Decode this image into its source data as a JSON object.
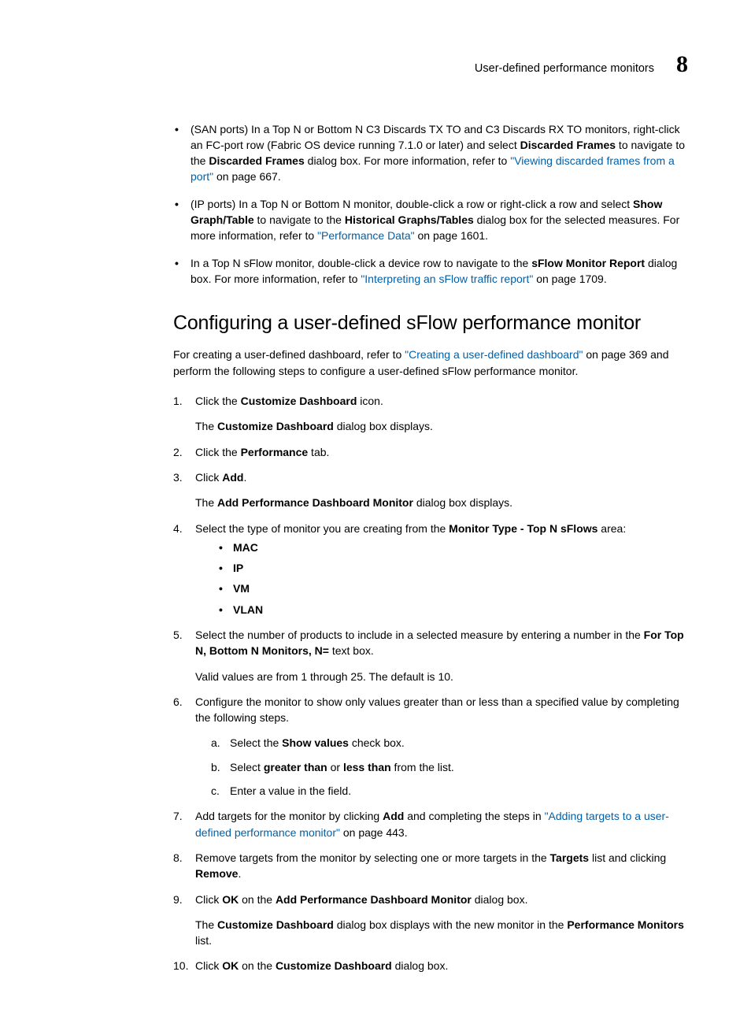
{
  "runningHead": {
    "title": "User-defined performance monitors",
    "chapter": "8"
  },
  "topBullets": [
    {
      "pre": "(SAN ports) In a Top N or Bottom N C3 Discards TX TO and C3 Discards RX TO monitors, right-click an FC-port row (Fabric OS device running 7.1.0 or later) and select ",
      "bold1": "Discarded Frames",
      "mid1": " to navigate to the ",
      "bold2": "Discarded Frames",
      "mid2": " dialog box. For more information, refer to ",
      "link": "\"Viewing discarded frames from a port\"",
      "post": " on page 667."
    },
    {
      "pre": "(IP ports) In a Top N or Bottom N monitor, double-click a row or right-click a row and select ",
      "bold1": "Show Graph/Table",
      "mid1": " to navigate to the ",
      "bold2": "Historical Graphs/Tables",
      "mid2": " dialog box for the selected measures. For more information, refer to ",
      "link": "\"Performance Data\"",
      "post": " on page 1601."
    },
    {
      "pre": "In a Top N sFlow monitor, double-click a device row to navigate to the ",
      "bold1": "sFlow Monitor Report",
      "mid1": " dialog box. For more information, refer to ",
      "bold2": "",
      "mid2": "",
      "link": "\"Interpreting an sFlow traffic report\"",
      "post": " on page 1709."
    }
  ],
  "section": {
    "title": "Configuring a user-defined sFlow performance monitor"
  },
  "intro": {
    "pre": "For creating a user-defined dashboard, refer to ",
    "link": "\"Creating a user-defined dashboard\"",
    "post": " on page 369 and perform the following steps to configure a user-defined sFlow performance monitor."
  },
  "steps": {
    "s1": {
      "pre": "Click the ",
      "bold": "Customize Dashboard",
      "post": " icon.",
      "para_pre": "The ",
      "para_bold": "Customize Dashboard",
      "para_post": " dialog box displays."
    },
    "s2": {
      "pre": "Click the ",
      "bold": "Performance",
      "post": " tab."
    },
    "s3": {
      "pre": "Click ",
      "bold": "Add",
      "post": ".",
      "para_pre": "The ",
      "para_bold": "Add Performance Dashboard Monitor",
      "para_post": " dialog box displays."
    },
    "s4": {
      "pre": "Select the type of monitor you are creating from the ",
      "bold": "Monitor Type - Top N sFlows",
      "post": " area:",
      "opts": [
        "MAC",
        "IP",
        "VM",
        "VLAN"
      ]
    },
    "s5": {
      "pre": "Select the number of products to include in a selected measure by entering a number in the ",
      "bold": "For Top N, Bottom N Monitors, N=",
      "post": " text box.",
      "para": "Valid values are from 1 through 25. The default is 10."
    },
    "s6": {
      "text": "Configure the monitor to show only values greater than or less than a specified value by completing the following steps.",
      "a_pre": "Select the ",
      "a_bold": "Show values",
      "a_post": " check box.",
      "b_pre": "Select ",
      "b_bold1": "greater than",
      "b_mid": " or ",
      "b_bold2": "less than",
      "b_post": " from the list.",
      "c": "Enter a value in the field."
    },
    "s7": {
      "pre": "Add targets for the monitor by clicking ",
      "bold": "Add",
      "mid": " and completing the steps in ",
      "link": "\"Adding targets to a user-defined performance monitor\"",
      "post": " on page 443."
    },
    "s8": {
      "pre": "Remove targets from the monitor by selecting one or more targets in the ",
      "bold1": "Targets",
      "mid": " list and clicking ",
      "bold2": "Remove",
      "post": "."
    },
    "s9": {
      "pre": "Click ",
      "bold1": "OK",
      "mid": " on the ",
      "bold2": "Add Performance Dashboard Monitor",
      "post": " dialog box.",
      "para_pre": "The ",
      "para_bold1": "Customize Dashboard",
      "para_mid": " dialog box displays with the new monitor in the ",
      "para_bold2": "Performance Monitors",
      "para_post": " list."
    },
    "s10": {
      "pre": "Click ",
      "bold1": "OK",
      "mid": " on the ",
      "bold2": "Customize Dashboard",
      "post": " dialog box."
    }
  }
}
